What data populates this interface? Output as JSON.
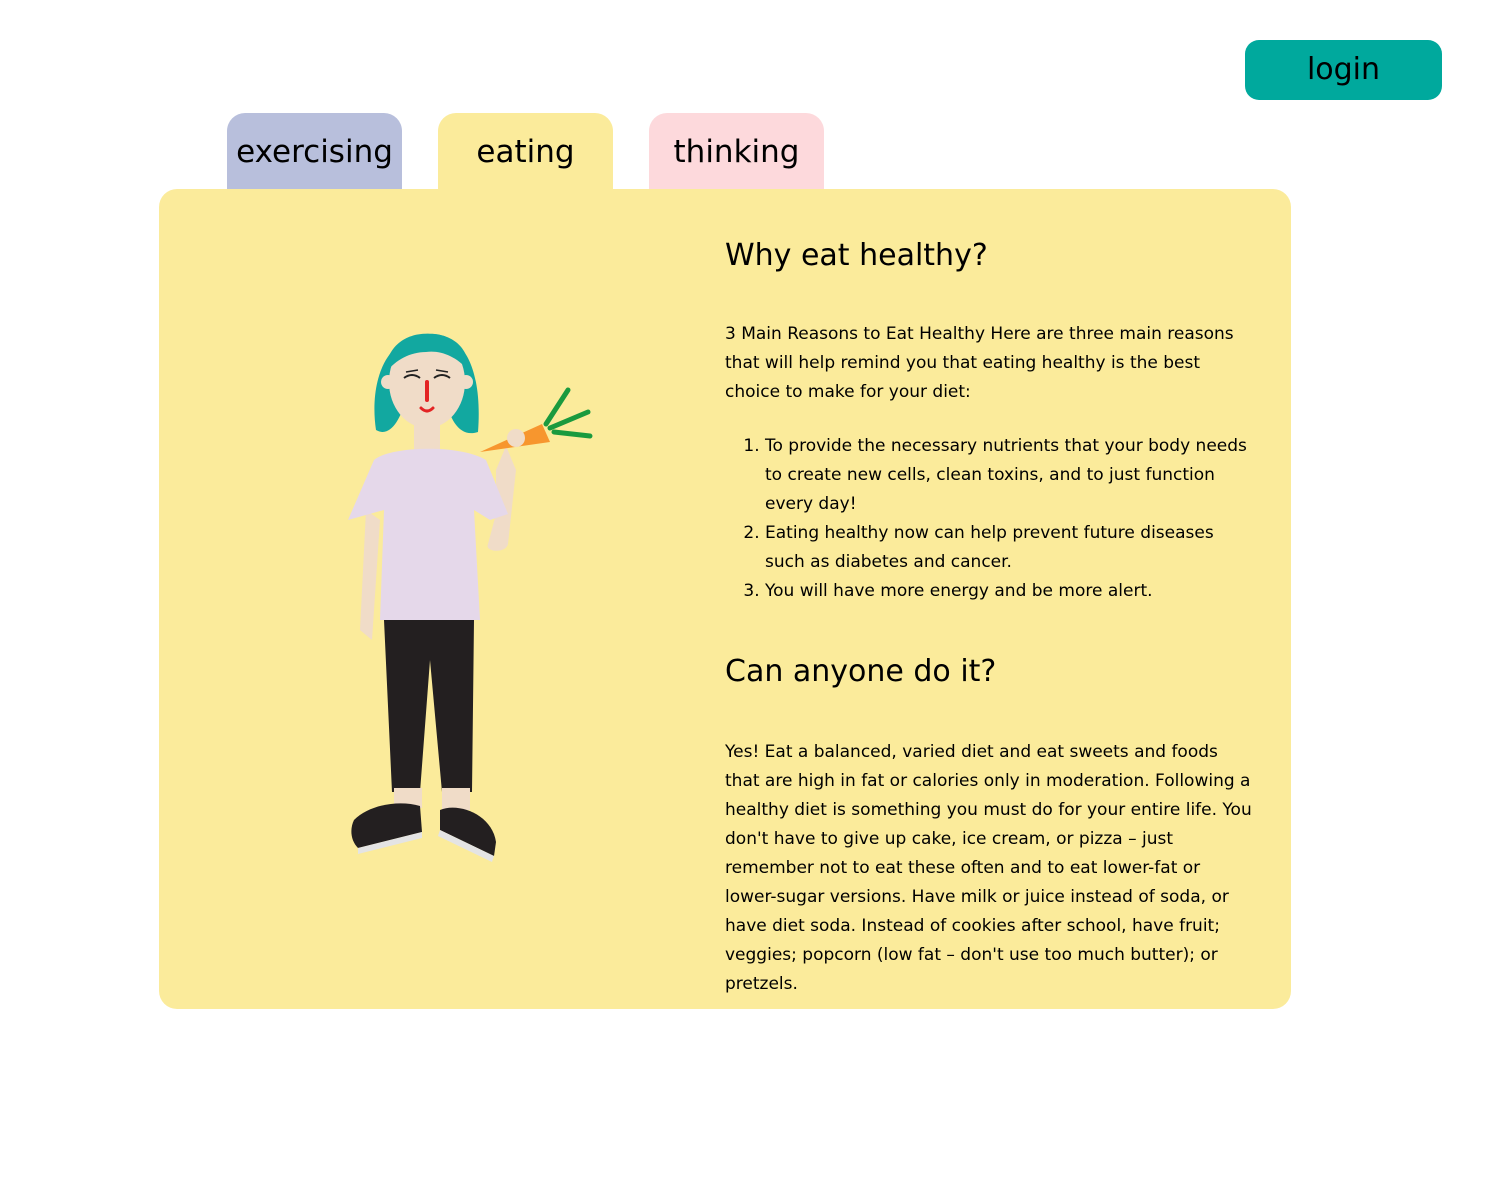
{
  "header": {
    "login_label": "login"
  },
  "tabs": [
    {
      "label": "exercising",
      "color": "#b8bfdc"
    },
    {
      "label": "eating",
      "color": "#fbeb9b",
      "active": true
    },
    {
      "label": "thinking",
      "color": "#fdd9dc"
    }
  ],
  "colors": {
    "accent": "#00a99d",
    "panel": "#fbeb9b"
  },
  "illustration": {
    "icon": "person-eating-carrot-illustration"
  },
  "content": {
    "heading_why": "Why eat healthy?",
    "intro": "3 Main Reasons to Eat Healthy Here are three main reasons that will help remind you that eating healthy is the best choice to make for your diet:",
    "reasons": [
      "To provide the necessary nutrients that your body needs to create new cells, clean toxins, and to just function every day!",
      "Eating healthy now can help prevent future diseases such as diabetes and cancer.",
      "You will have more energy and be more alert."
    ],
    "heading_can": "Can anyone do it?",
    "answer": "Yes! Eat a balanced, varied diet and eat sweets and foods that are high in fat or calories only in moderation. Following a healthy diet is something you must do for your entire life. You don't have to give up cake, ice cream, or pizza – just remember not to eat these often and to eat lower-fat or lower-sugar versions. Have milk or juice instead of soda, or have diet soda. Instead of cookies after school, have fruit; veggies; popcorn (low fat – don't use too much butter); or pretzels."
  }
}
